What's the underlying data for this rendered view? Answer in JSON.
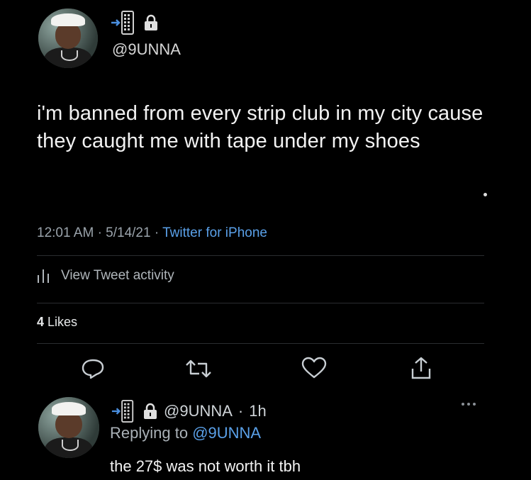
{
  "tweet": {
    "handle": "@9UNNA",
    "text": "i'm banned from every strip club in my city cause they caught me with tape under my shoes",
    "time": "12:01 AM",
    "date": "5/14/21",
    "source": "Twitter for iPhone",
    "activity_label": "View Tweet activity",
    "likes_count": "4",
    "likes_label": "Likes"
  },
  "reply": {
    "handle": "@9UNNA",
    "age": "1h",
    "replying_prefix": "Replying to",
    "replying_to": "@9UNNA",
    "text": "the 27$ was not worth it tbh"
  },
  "icons": {
    "phone_arrow": "phone-arrow-icon",
    "lock": "lock-icon",
    "chart": "bar-chart-icon",
    "reply": "comment-icon",
    "retweet": "retweet-icon",
    "like": "heart-icon",
    "share": "share-icon",
    "more": "more-dots-icon"
  },
  "colors": {
    "background": "#000000",
    "link": "#5aa0e8",
    "text": "#f2f2f2",
    "muted": "#9aa3ab"
  }
}
